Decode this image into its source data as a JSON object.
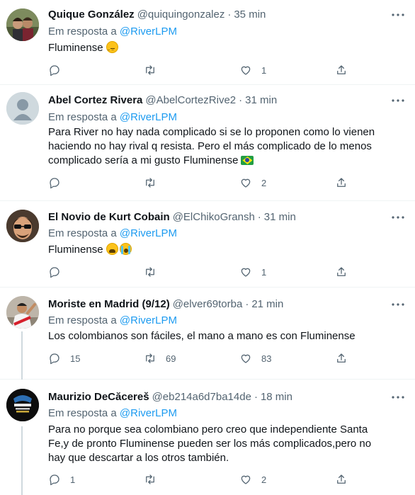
{
  "icons": {
    "reply": "reply-icon",
    "retweet": "retweet-icon",
    "like": "heart-icon",
    "share": "share-icon",
    "more": "more-icon"
  },
  "colors": {
    "link": "#1d9bf0",
    "secondary_text": "#536471",
    "primary_text": "#0f1419",
    "divider": "#eff3f4"
  },
  "tweets": [
    {
      "name": "Quique González",
      "handle": "@quiquingonzalez",
      "dot": "·",
      "time": "35 min",
      "reply_prefix": "Em resposta a",
      "reply_to": "@RiverLPM",
      "text": "Fluminense",
      "emoji": [
        "pensive-face"
      ],
      "replies": "",
      "retweets": "",
      "likes": "1"
    },
    {
      "name": "Abel Cortez Rivera",
      "handle": "@AbelCortezRive2",
      "dot": "·",
      "time": "31 min",
      "reply_prefix": "Em resposta a",
      "reply_to": "@RiverLPM",
      "text": "Para River no hay nada complicado si se lo proponen como lo vienen haciendo no hay rival q resista. Pero el más complicado de lo menos complicado sería a mi gusto Fluminense",
      "emoji": [
        "brazil-flag"
      ],
      "replies": "",
      "retweets": "",
      "likes": "2"
    },
    {
      "name": "El Novio de Kurt Cobain",
      "handle": "@ElChikoGransh",
      "dot": "·",
      "time": "31 min",
      "reply_prefix": "Em resposta a",
      "reply_to": "@RiverLPM",
      "text": "Fluminense",
      "emoji": [
        "tired-face",
        "loudly-crying-face"
      ],
      "replies": "",
      "retweets": "",
      "likes": "1"
    },
    {
      "name": "Moriste en Madrid (9/12)",
      "handle": "@elver69torba",
      "dot": "·",
      "time": "21 min",
      "reply_prefix": "Em resposta a",
      "reply_to": "@RiverLPM",
      "text": "Los colombianos son fáciles, el mano a mano es con Fluminense",
      "emoji": [],
      "replies": "15",
      "retweets": "69",
      "likes": "83"
    },
    {
      "name": "Maurizio DeCăcereš",
      "handle": "@eb214a6d7ba14de",
      "dot": "·",
      "time": "18 min",
      "reply_prefix": "Em resposta a",
      "reply_to": "@RiverLPM",
      "text": "Para no porque sea colombiano pero creo que independiente Santa Fe,y de pronto Fluminense pueden ser los más complicados,pero no hay que descartar a los otros también.",
      "emoji": [],
      "replies": "1",
      "retweets": "",
      "likes": "2"
    }
  ]
}
